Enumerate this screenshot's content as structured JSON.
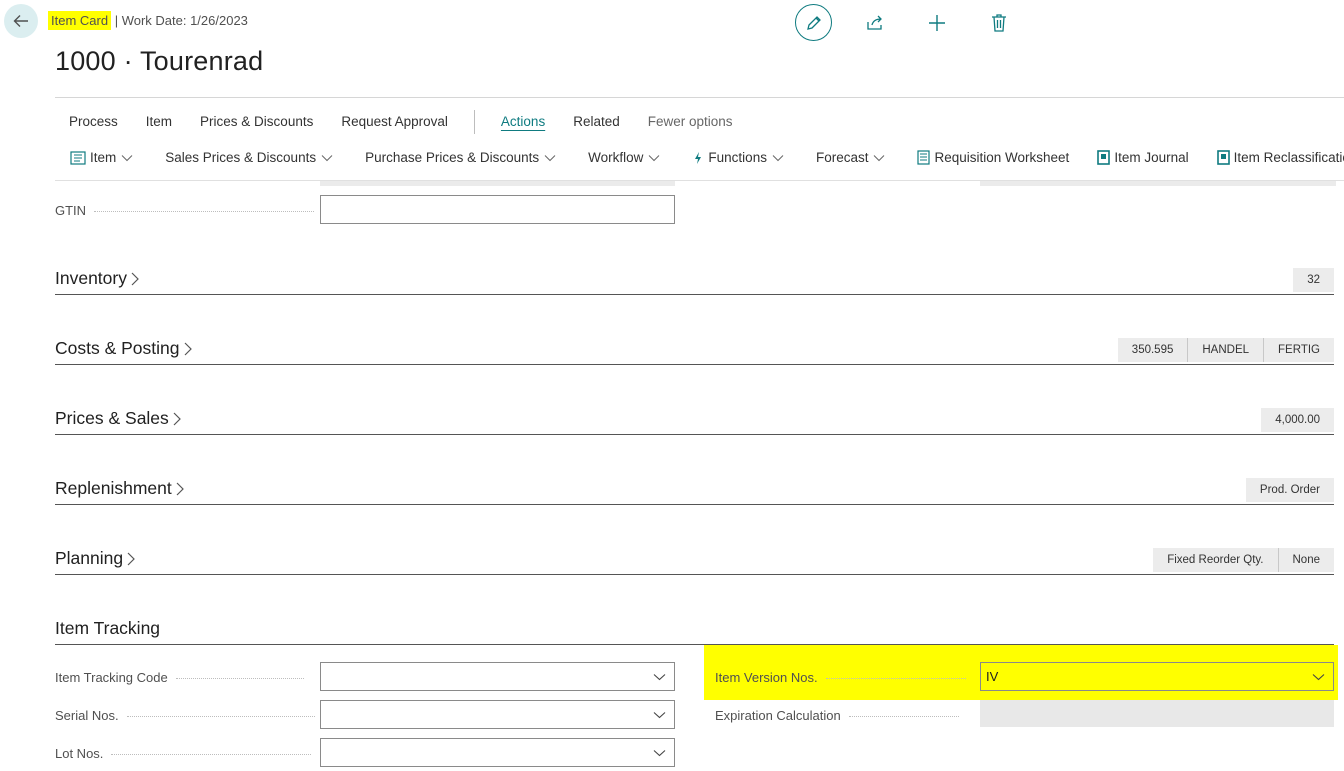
{
  "header": {
    "page_type": "Item Card",
    "work_date": "| Work Date: 1/26/2023",
    "title": "1000 · Tourenrad"
  },
  "toolbar_icons": [
    "edit-icon",
    "share-icon",
    "add-icon",
    "delete-icon"
  ],
  "menu_primary": [
    {
      "label": "Process"
    },
    {
      "label": "Item"
    },
    {
      "label": "Prices & Discounts"
    },
    {
      "label": "Request Approval"
    },
    {
      "label": "Actions"
    },
    {
      "label": "Related"
    },
    {
      "label": "Fewer options"
    }
  ],
  "menu_secondary": [
    {
      "label": "Item",
      "icon": "item-card-icon"
    },
    {
      "label": "Sales Prices & Discounts"
    },
    {
      "label": "Purchase Prices & Discounts"
    },
    {
      "label": "Workflow"
    },
    {
      "label": "Functions",
      "icon": "lightning-icon"
    },
    {
      "label": "Forecast"
    },
    {
      "label": "Requisition Worksheet",
      "icon": "worksheet-icon"
    },
    {
      "label": "Item Journal",
      "icon": "journal-icon"
    },
    {
      "label": "Item Reclassification",
      "icon": "journal-icon"
    }
  ],
  "gtin": {
    "label": "GTIN",
    "value": ""
  },
  "sections": {
    "inventory": {
      "title": "Inventory",
      "chips": [
        "32"
      ]
    },
    "costs": {
      "title": "Costs & Posting",
      "chips": [
        "350.595",
        "HANDEL",
        "FERTIG"
      ]
    },
    "prices": {
      "title": "Prices & Sales",
      "chips": [
        "4,000.00"
      ]
    },
    "replenishment": {
      "title": "Replenishment",
      "chips": [
        "Prod. Order"
      ]
    },
    "planning": {
      "title": "Planning",
      "chips": [
        "Fixed Reorder Qty.",
        "None"
      ]
    },
    "tracking": {
      "title": "Item Tracking"
    }
  },
  "tracking_fields": {
    "item_tracking_code": {
      "label": "Item Tracking Code",
      "value": ""
    },
    "serial_nos": {
      "label": "Serial Nos.",
      "value": ""
    },
    "lot_nos": {
      "label": "Lot Nos.",
      "value": ""
    },
    "item_version_nos": {
      "label": "Item Version Nos.",
      "value": "IV"
    },
    "expiration_calc": {
      "label": "Expiration Calculation",
      "value": ""
    }
  },
  "colors": {
    "accent": "#0f7b80",
    "highlight": "#ffff00"
  }
}
